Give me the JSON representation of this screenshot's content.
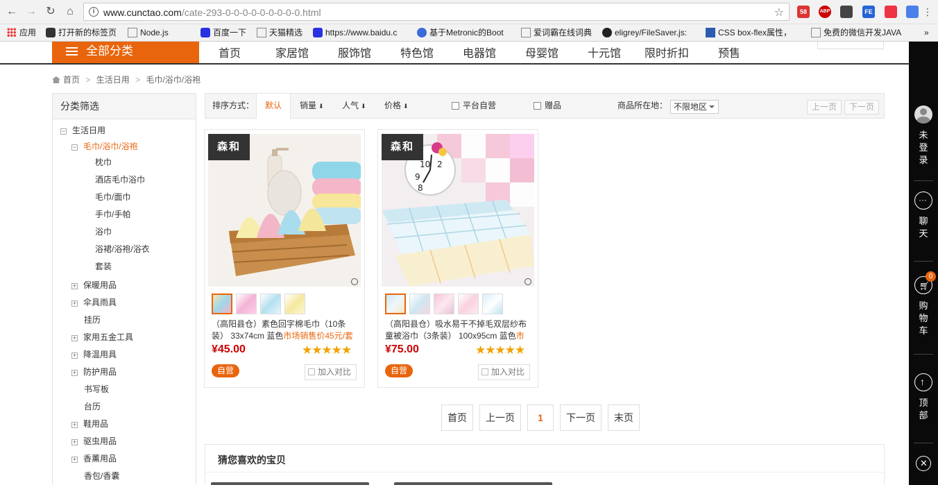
{
  "browser": {
    "url_host": "www.cunctao.com",
    "url_path": "/cate-293-0-0-0-0-0-0-0-0-0.html",
    "extensions": {
      "badge_count": "58",
      "abp_label": "ABP",
      "fe_label": "FE"
    }
  },
  "bookmarks": [
    {
      "label": "应用"
    },
    {
      "label": "打开新的标签页"
    },
    {
      "label": "Node.js"
    },
    {
      "label": "百度一下"
    },
    {
      "label": "天猫精选"
    },
    {
      "label": "https://www.baidu.c"
    },
    {
      "label": "基于Metronic的Boot"
    },
    {
      "label": "爱词霸在线词典"
    },
    {
      "label": "eligrey/FileSaver.js:"
    },
    {
      "label": "CSS box-flex属性，"
    },
    {
      "label": "免费的微信开发JAVA"
    }
  ],
  "bookmarks_more": "»",
  "header": {
    "all_categories": "全部分类",
    "nav": [
      "首页",
      "家居馆",
      "服饰馆",
      "特色馆",
      "电器馆",
      "母婴馆",
      "十元馆",
      "限时折扣",
      "预售"
    ]
  },
  "breadcrumb": {
    "home": "首页",
    "level1": "生活日用",
    "level2": "毛巾/浴巾/浴袍",
    "sep": ">"
  },
  "sidebar": {
    "title": "分类筛选",
    "root": "生活日用",
    "active": "毛巾/浴巾/浴袍",
    "subitems": [
      "枕巾",
      "酒店毛巾浴巾",
      "毛巾/面巾",
      "手巾/手帕",
      "浴巾",
      "浴裙/浴袍/浴衣",
      "套装"
    ],
    "categories": [
      {
        "label": "保暖用品",
        "expandable": true
      },
      {
        "label": "伞具雨具",
        "expandable": true
      },
      {
        "label": "挂历",
        "expandable": false
      },
      {
        "label": "家用五金工具",
        "expandable": true
      },
      {
        "label": "降温用具",
        "expandable": true
      },
      {
        "label": "防护用品",
        "expandable": true
      },
      {
        "label": "书写板",
        "expandable": false
      },
      {
        "label": "台历",
        "expandable": false
      },
      {
        "label": "鞋用品",
        "expandable": true
      },
      {
        "label": "驱虫用品",
        "expandable": true
      },
      {
        "label": "香薰用品",
        "expandable": true
      },
      {
        "label": "香包/香囊",
        "expandable": false
      }
    ]
  },
  "toolbar": {
    "sort_label": "排序方式：",
    "sort_default": "默认",
    "sort_sales": "销量",
    "sort_popularity": "人气",
    "sort_price": "价格",
    "filter_self": "平台自营",
    "filter_gift": "赠品",
    "location_label": "商品所在地：",
    "location_value": "不限地区",
    "prev_page": "上一页",
    "next_page": "下一页"
  },
  "products": [
    {
      "brand": "森和",
      "title": "（高阳县仓）素色回字棉毛巾（10条装） 33x74cm 蓝色",
      "promo": "市场销售价45元/套",
      "price": "¥45.00",
      "stars": "★★★★★",
      "badge": "自营",
      "compare": "加入对比"
    },
    {
      "brand": "森和",
      "title": "（高阳县仓）吸水易干不掉毛双层纱布童被浴巾（3条装） 100x95cm 蓝色",
      "promo": "市",
      "price": "¥75.00",
      "stars": "★★★★★",
      "badge": "自营",
      "compare": "加入对比"
    }
  ],
  "pagination": {
    "first": "首页",
    "prev": "上一页",
    "current": "1",
    "next": "下一页",
    "last": "末页"
  },
  "recommend": {
    "title": "猜您喜欢的宝贝"
  },
  "rightbar": {
    "login": "未登录",
    "chat": "聊天",
    "cart": "购物车",
    "cart_count": "0",
    "top": "顶部",
    "close_icon": "close-icon"
  }
}
